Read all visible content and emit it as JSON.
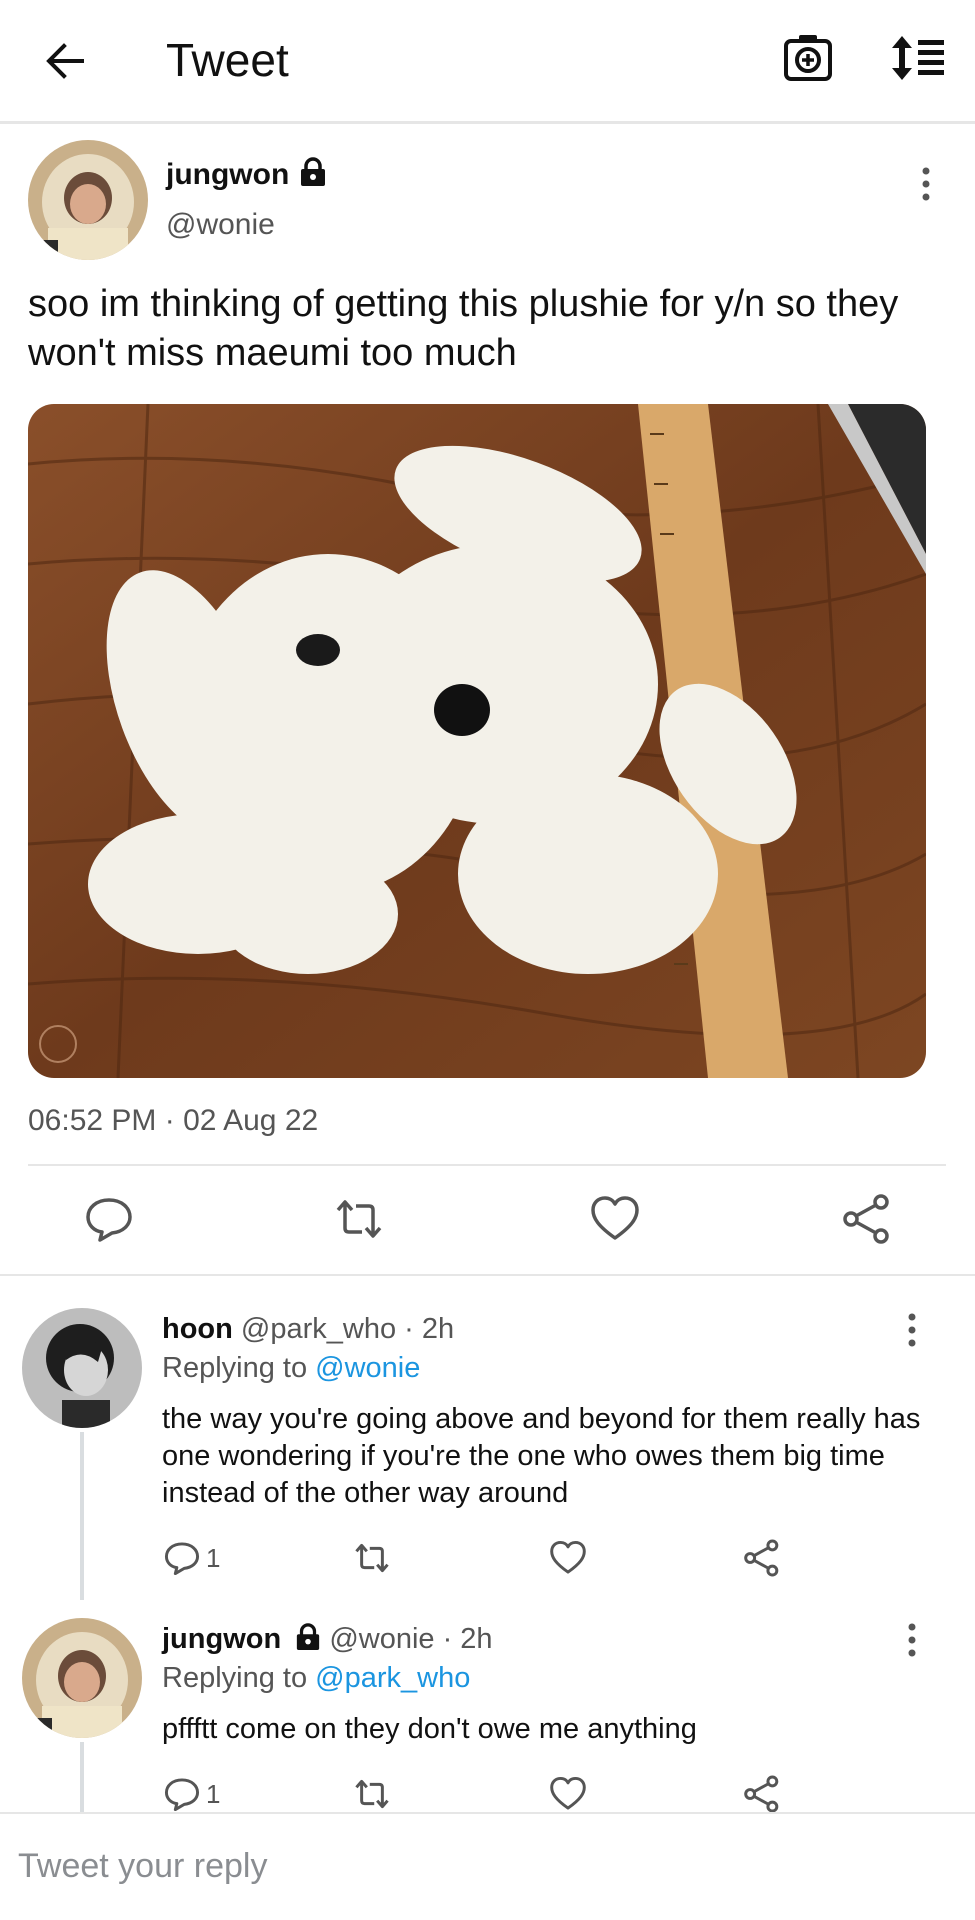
{
  "header": {
    "title": "Tweet",
    "back_icon": "arrow-left-icon",
    "camera_icon": "camera-plus-icon",
    "sort_icon": "sort-list-icon"
  },
  "main_tweet": {
    "name": "jungwon",
    "handle": "@wonie",
    "protected_icon": "lock-icon",
    "text": "soo im thinking of getting this plushie for y/n so they won't miss maeumi too much",
    "timestamp": "06:52 PM · 02 Aug 22",
    "actions": [
      "reply-icon",
      "retweet-icon",
      "like-icon",
      "share-icon"
    ]
  },
  "replies": [
    {
      "name": "hoon",
      "meta": "@park_who · 2h",
      "replying_prefix": "Replying to",
      "replying_to": "@wonie",
      "text": "the way you're going above and beyond for them really has one wondering if you're the one who owes them big time instead of the other way around",
      "reply_count": "1"
    },
    {
      "name": "jungwon",
      "meta": "@wonie · 2h",
      "replying_prefix": "Replying to",
      "replying_to": "@park_who",
      "text": "pffftt come on they don't owe me anything",
      "reply_count": "1"
    }
  ],
  "composer": {
    "placeholder": "Tweet your reply"
  },
  "colors": {
    "link": "#1b95e0",
    "secondary_text": "#555555",
    "divider": "#e6e6e6"
  }
}
